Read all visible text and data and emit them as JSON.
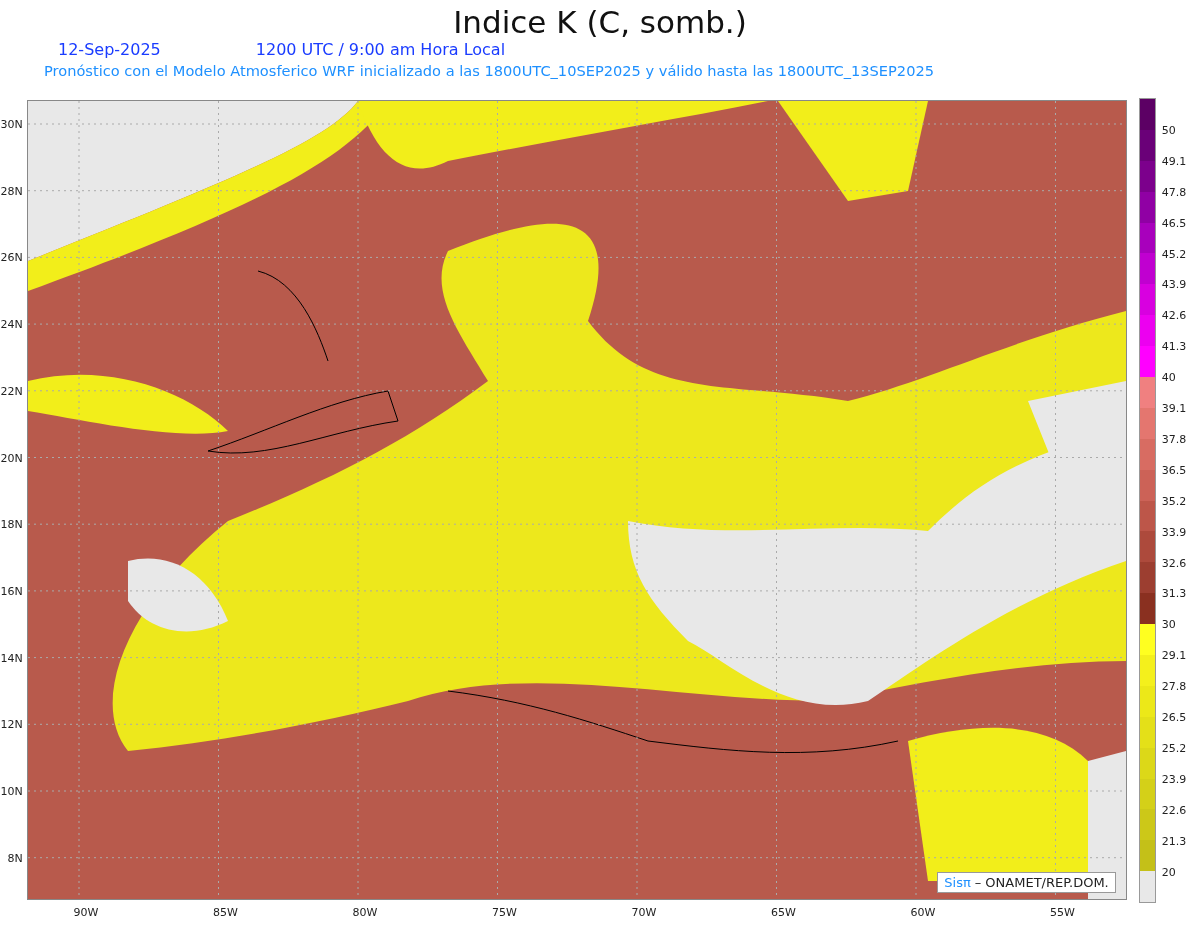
{
  "title": "Indice K (C, somb.)",
  "date": "12-Sep-2025",
  "time": "1200 UTC / 9:00 am Hora Local",
  "subtitle": "Pronóstico con el Modelo Atmosferico WRF inicializado a las 1800UTC_10SEP2025 y válido hasta las  1800UTC_13SEP2025",
  "y_axis": [
    "30N",
    "28N",
    "26N",
    "24N",
    "22N",
    "20N",
    "18N",
    "16N",
    "14N",
    "12N",
    "10N",
    "8N"
  ],
  "x_axis": [
    "90W",
    "85W",
    "80W",
    "75W",
    "70W",
    "65W",
    "60W",
    "55W"
  ],
  "colorbar": [
    {
      "color": "#5c0064",
      "label": "50"
    },
    {
      "color": "#6a0078",
      "label": "49.1"
    },
    {
      "color": "#7c008c",
      "label": "47.8"
    },
    {
      "color": "#9000a4",
      "label": "46.5"
    },
    {
      "color": "#a800bc",
      "label": "45.2"
    },
    {
      "color": "#c000d0",
      "label": "43.9"
    },
    {
      "color": "#d800e0",
      "label": "42.6"
    },
    {
      "color": "#ec00f0",
      "label": "41.3"
    },
    {
      "color": "#ff00ff",
      "label": "40"
    },
    {
      "color": "#f08080",
      "label": "39.1"
    },
    {
      "color": "#e4766f",
      "label": "37.8"
    },
    {
      "color": "#d86c62",
      "label": "36.5"
    },
    {
      "color": "#cc6257",
      "label": "35.2"
    },
    {
      "color": "#bd5649",
      "label": "33.9"
    },
    {
      "color": "#ad4a3c",
      "label": "32.6"
    },
    {
      "color": "#9c3e30",
      "label": "31.3"
    },
    {
      "color": "#8a3020",
      "label": "30"
    },
    {
      "color": "#ffff20",
      "label": "29.1"
    },
    {
      "color": "#f4f01c",
      "label": "27.8"
    },
    {
      "color": "#ece818",
      "label": "26.5"
    },
    {
      "color": "#e4e018",
      "label": "25.2"
    },
    {
      "color": "#dcd818",
      "label": "23.9"
    },
    {
      "color": "#d4d018",
      "label": "22.6"
    },
    {
      "color": "#ccc818",
      "label": "21.3"
    },
    {
      "color": "#c4c018",
      "label": "20"
    },
    {
      "color": "#e8e8e8"
    }
  ],
  "credit": {
    "brand": "Sisπ",
    "text": "– ONAMET/REP.DOM."
  }
}
